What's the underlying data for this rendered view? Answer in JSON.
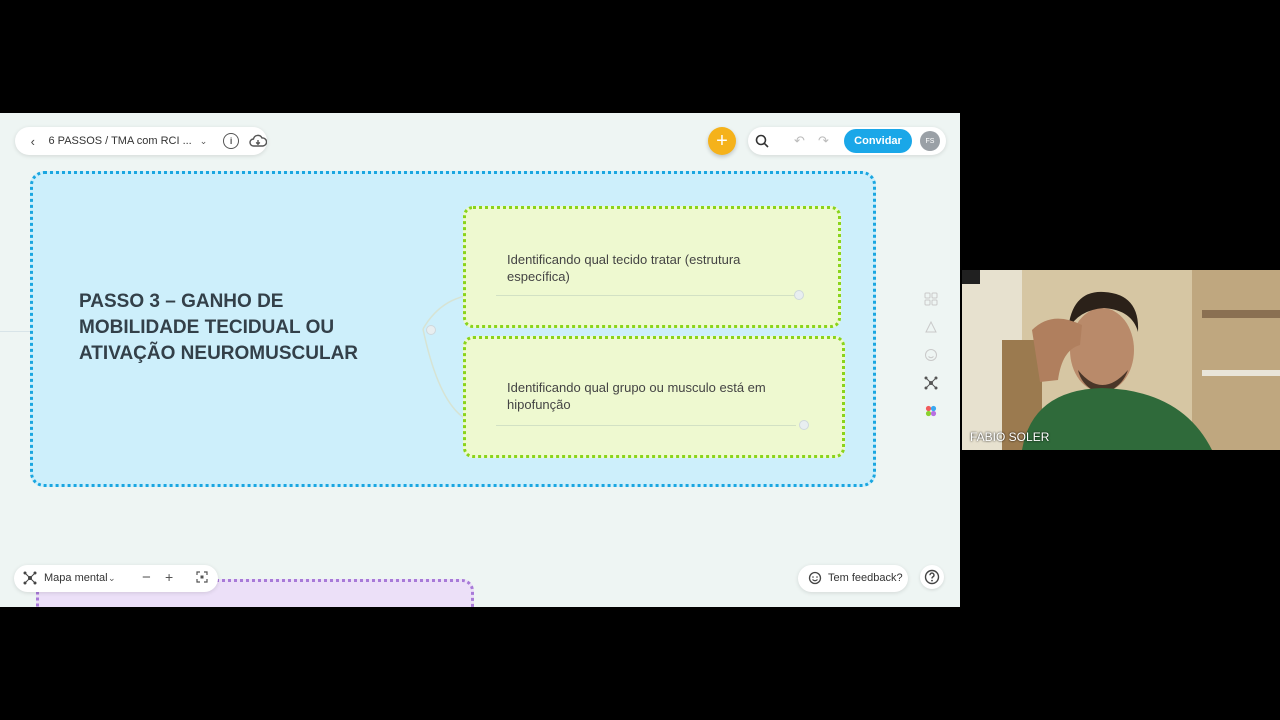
{
  "topbar": {
    "back_icon": "chevron-left-icon",
    "doc_title": "6 PASSOS / TMA com RCI ...",
    "info_icon": "info-icon",
    "cloud_icon": "cloud-download-icon"
  },
  "toolbar": {
    "add_icon": "plus-icon",
    "search_icon": "search-icon",
    "undo_icon": "undo-icon",
    "redo_icon": "redo-icon",
    "invite_label": "Convidar",
    "avatar_initials": "FS"
  },
  "canvas": {
    "main_node": "PASSO 3 – GANHO DE MOBILIDADE TECIDUAL OU ATIVAÇÃO NEUROMUSCULAR",
    "child_nodes": [
      "Identificando qual tecido tratar (estrutura específica)",
      "Identificando qual grupo ou musculo está em hipofunção"
    ],
    "colors": {
      "main_fill": "#cdeffb",
      "main_border": "#1aa6e0",
      "child_fill": "#eef9d0",
      "child_border": "#8ad41a",
      "purple_border": "#a87ad8"
    }
  },
  "side_tools": [
    "layout-icon",
    "style-icon",
    "emoji-icon",
    "mindmap-icon",
    "color-palette-icon"
  ],
  "bottom": {
    "map_type_label": "Mapa mental",
    "zoom_out": "−",
    "zoom_in": "+",
    "fit_icon": "fit-screen-icon",
    "feedback_label": "Tem feedback?",
    "help_icon": "help-icon"
  },
  "webcam": {
    "participant_name": "FABIO SOLER"
  }
}
